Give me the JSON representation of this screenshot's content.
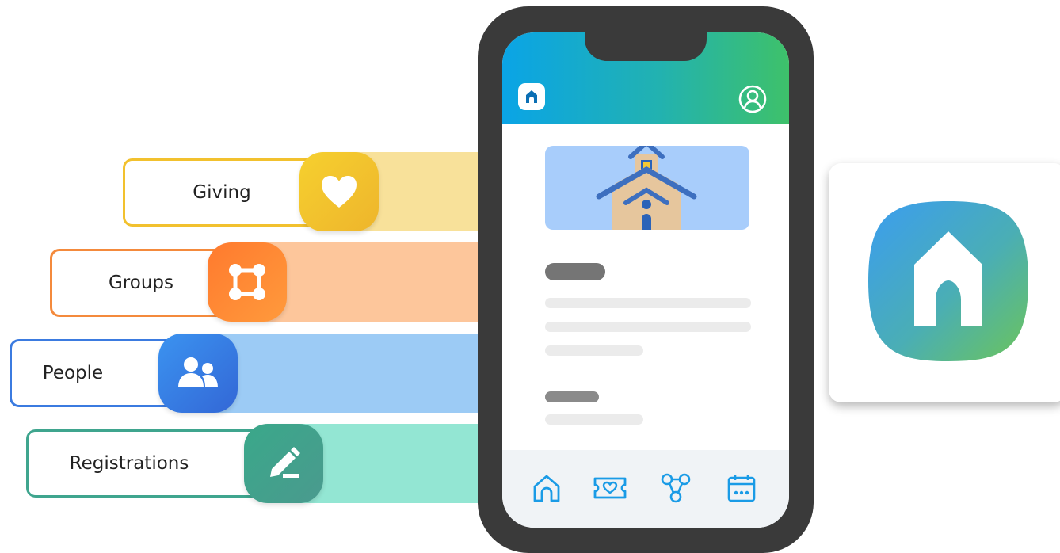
{
  "features": [
    {
      "label": "Giving",
      "icon": "heart-icon",
      "color": "#f2c12e"
    },
    {
      "label": "Groups",
      "icon": "groups-icon",
      "color": "#ff8a3d"
    },
    {
      "label": "People",
      "icon": "people-icon",
      "color": "#3b82e6"
    },
    {
      "label": "Registrations",
      "icon": "pencil-icon",
      "color": "#3fa58e"
    }
  ],
  "phone": {
    "header_gradient": [
      "#0aa4e6",
      "#3ec16a"
    ],
    "nav_items": [
      "home-icon",
      "giving-ticket-icon",
      "groups-network-icon",
      "calendar-icon"
    ]
  }
}
